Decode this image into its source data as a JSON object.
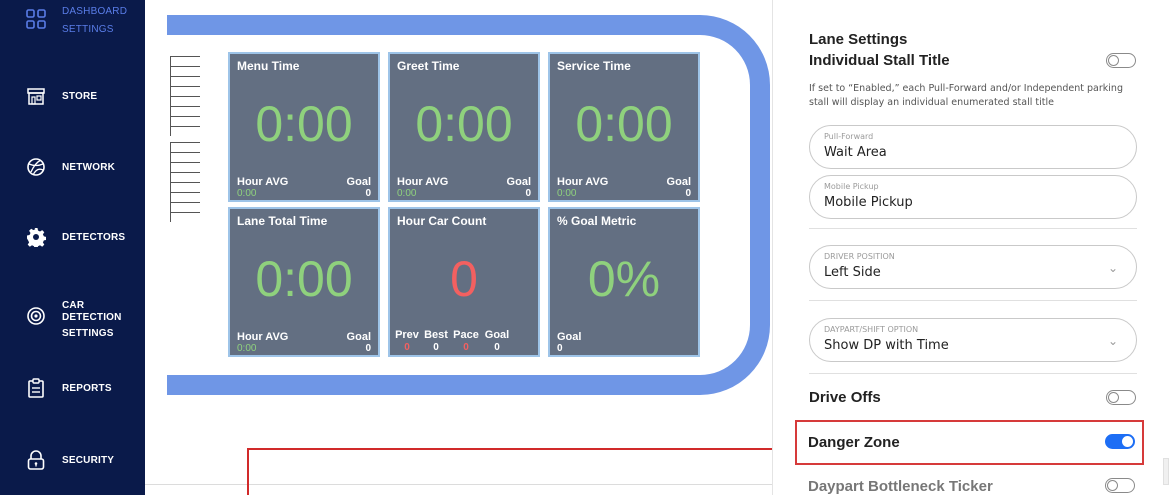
{
  "sidebar": {
    "items": [
      {
        "label": "DASHBOARD SETTINGS",
        "icon": "grid-icon",
        "active": true
      },
      {
        "label": "STORE",
        "icon": "store-icon"
      },
      {
        "label": "NETWORK",
        "icon": "network-icon"
      },
      {
        "label": "DETECTORS",
        "icon": "gear-icon"
      },
      {
        "label": "CAR DETECTION SETTINGS",
        "icon": "car-detection-icon"
      },
      {
        "label": "REPORTS",
        "icon": "clipboard-icon"
      },
      {
        "label": "SECURITY",
        "icon": "lock-icon"
      }
    ],
    "dashboard_line1": "DASHBOARD",
    "dashboard_line2": "SETTINGS",
    "car_line1": "CAR DETECTION",
    "car_line2": "SETTINGS"
  },
  "tiles": {
    "menu": {
      "title": "Menu Time",
      "value": "0:00",
      "left_label": "Hour AVG",
      "left_value": "0:00",
      "right_label": "Goal",
      "right_value": "0"
    },
    "greet": {
      "title": "Greet Time",
      "value": "0:00",
      "left_label": "Hour AVG",
      "left_value": "0:00",
      "right_label": "Goal",
      "right_value": "0"
    },
    "service": {
      "title": "Service Time",
      "value": "0:00",
      "left_label": "Hour AVG",
      "left_value": "0:00",
      "right_label": "Goal",
      "right_value": "0"
    },
    "lane_total": {
      "title": "Lane Total Time",
      "value": "0:00",
      "left_label": "Hour AVG",
      "left_value": "0:00",
      "right_label": "Goal",
      "right_value": "0"
    },
    "car_count": {
      "title": "Hour Car Count",
      "value": "0",
      "prev_label": "Prev",
      "prev_value": "0",
      "best_label": "Best",
      "best_value": "0",
      "pace_label": "Pace",
      "pace_value": "0",
      "goal_label": "Goal",
      "goal_value": "0"
    },
    "goal_metric": {
      "title": "% Goal Metric",
      "value": "0%",
      "goal_label": "Goal",
      "goal_value": "0"
    }
  },
  "panel": {
    "section_title": "Lane Settings",
    "stall_title": "Individual Stall Title",
    "stall_enabled": false,
    "stall_desc": "If set to “Enabled,” each Pull-Forward and/or Independent parking stall will display an individual enumerated stall title",
    "pull_forward": {
      "label": "Pull-Forward",
      "value": "Wait Area"
    },
    "mobile_pickup": {
      "label": "Mobile Pickup",
      "value": "Mobile Pickup"
    },
    "driver_position": {
      "label": "DRIVER POSITION",
      "value": "Left Side"
    },
    "daypart": {
      "label": "DAYPART/SHIFT OPTION",
      "value": "Show DP with Time"
    },
    "drive_offs": {
      "label": "Drive Offs",
      "enabled": false
    },
    "danger_zone": {
      "label": "Danger Zone",
      "enabled": true
    },
    "daypart_ticker": {
      "label": "Daypart Bottleneck Ticker",
      "enabled": false
    }
  },
  "colors": {
    "sidebar_bg": "#0a1a4a",
    "accent": "#1d6ef5",
    "frame": "#6f96e6",
    "tile_bg": "#636f82",
    "good": "#8fd17d",
    "bad": "#f36060",
    "highlight": "#d63a3a"
  }
}
